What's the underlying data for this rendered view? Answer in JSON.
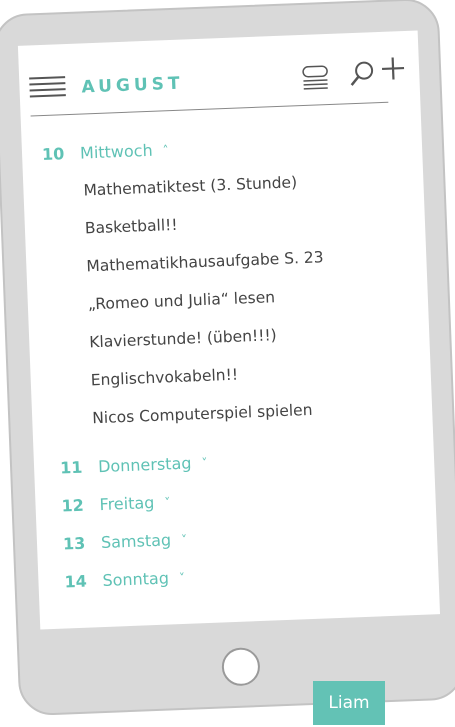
{
  "header": {
    "title": "AUGUST"
  },
  "agenda": {
    "expanded_day": {
      "number": "10",
      "name": "Mittwoch",
      "tasks": [
        "Mathematiktest (3. Stunde)",
        "Basketball!!",
        "Mathematikhausaufgabe S. 23",
        "„Romeo und Julia“ lesen",
        "Klavierstunde! (üben!!!)",
        "Englischvokabeln!!",
        "Nicos Computerspiel spielen"
      ]
    },
    "collapsed_days": [
      {
        "number": "11",
        "name": "Donnerstag"
      },
      {
        "number": "12",
        "name": "Freitag"
      },
      {
        "number": "13",
        "name": "Samstag"
      },
      {
        "number": "14",
        "name": "Sonntag"
      }
    ]
  },
  "chevrons": {
    "up": "˄",
    "down": "˅"
  },
  "user": {
    "name": "Liam"
  },
  "colors": {
    "accent": "#5fc2b5",
    "device": "#d9d9d9",
    "text": "#444444"
  },
  "icons": [
    "menu-icon",
    "list-icon",
    "search-icon",
    "add-icon",
    "chevron-up-icon",
    "chevron-down-icon"
  ]
}
